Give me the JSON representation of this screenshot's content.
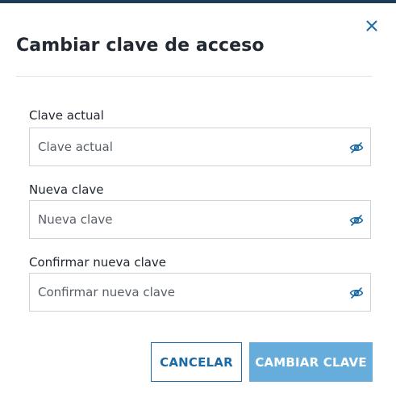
{
  "dialog": {
    "title": "Cambiar clave de acceso",
    "close_icon": "close-icon"
  },
  "fields": [
    {
      "label": "Clave actual",
      "placeholder": "Clave actual",
      "value": "",
      "icon": "eye-slash-icon"
    },
    {
      "label": "Nueva clave",
      "placeholder": "Nueva clave",
      "value": "",
      "icon": "eye-slash-icon"
    },
    {
      "label": "Confirmar nueva clave",
      "placeholder": "Confirmar nueva clave",
      "value": "",
      "icon": "eye-slash-icon"
    }
  ],
  "actions": {
    "cancel_label": "CANCELAR",
    "submit_label": "CAMBIAR CLAVE"
  },
  "colors": {
    "top_bar": "#1f3a57",
    "accent": "#1c6aa6",
    "primary_button": "#66addb"
  }
}
